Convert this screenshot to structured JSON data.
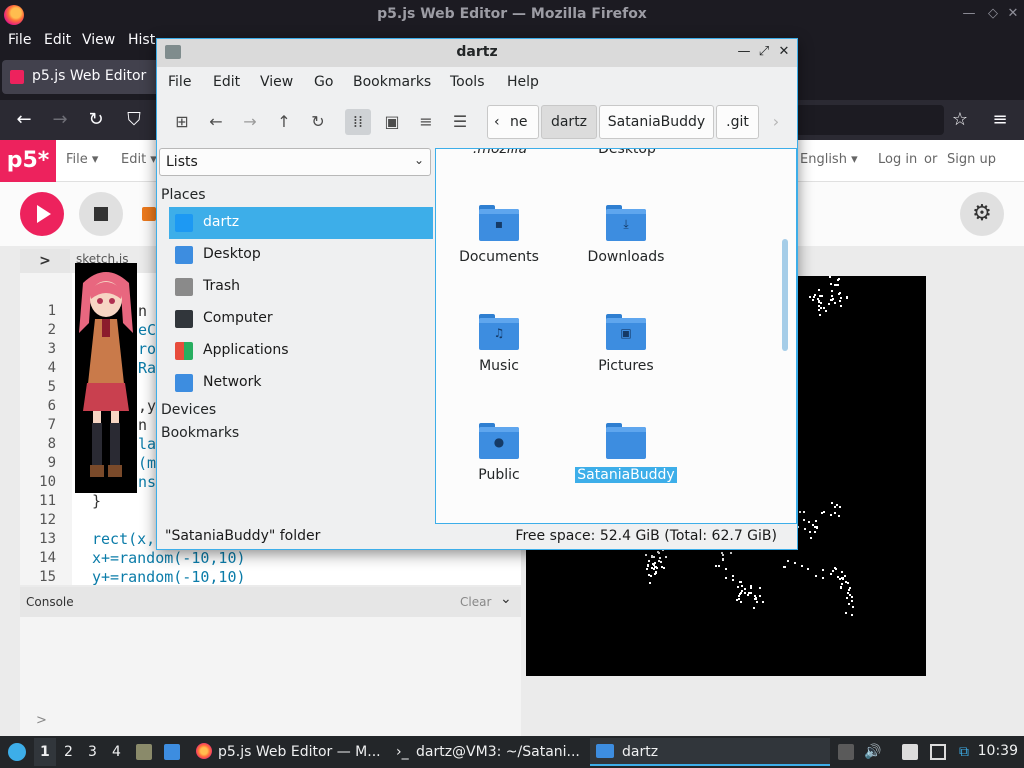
{
  "firefox": {
    "window_title": "p5.js Web Editor — Mozilla Firefox",
    "menu": [
      "File",
      "Edit",
      "View",
      "Hist"
    ],
    "tab_title": "p5.js Web Editor"
  },
  "p5": {
    "logo": "p5*",
    "menu": [
      "File ▾",
      "Edit ▾"
    ],
    "language": "English ▾",
    "login": "Log in",
    "or": "or",
    "signup": "Sign up",
    "sidebar_toggle": ">",
    "sketch_tab": "sketch.js",
    "line_numbers": [
      "1",
      "2",
      "3",
      "4",
      "5",
      "6",
      "7",
      "8",
      "9",
      "10",
      "11",
      "12",
      "13",
      "14",
      "15"
    ],
    "code_visible": {
      "l1": "n",
      "l2": "eC",
      "l3": "ro",
      "l4": "Ra",
      "l6": ",y",
      "l7": "n",
      "l8": "la",
      "l9": "(m",
      "l10": "ns",
      "l11": "}",
      "l13": "rect(x,",
      "l14": "x+=random(-10,10)",
      "l15": "y+=random(-10,10)"
    },
    "console": {
      "title": "Console",
      "clear": "Clear",
      "chevron": "⌄",
      "prompt": ">"
    }
  },
  "filemanager": {
    "title": "dartz",
    "menu": [
      "File",
      "Edit",
      "View",
      "Go",
      "Bookmarks",
      "Tools",
      "Help"
    ],
    "breadcrumbs": [
      "ne",
      "dartz",
      "SataniaBuddy",
      ".git"
    ],
    "places_select": "Lists",
    "sidebar_headers": {
      "places": "Places",
      "devices": "Devices",
      "bookmarks": "Bookmarks"
    },
    "places": [
      {
        "label": "dartz",
        "icon": "home-folder-icon",
        "color": "#1d99f3"
      },
      {
        "label": "Desktop",
        "icon": "desktop-icon",
        "color": "#3d8de0"
      },
      {
        "label": "Trash",
        "icon": "trash-icon",
        "color": "#8a8a8a"
      },
      {
        "label": "Computer",
        "icon": "computer-icon",
        "color": "#31363b"
      },
      {
        "label": "Applications",
        "icon": "applications-icon",
        "color": "#e74c3c"
      },
      {
        "label": "Network",
        "icon": "network-icon",
        "color": "#3d8de0"
      }
    ],
    "partial_labels": {
      "left": ".mozilla",
      "right": "Desktop"
    },
    "folders": [
      {
        "name": "Documents",
        "glyph": "▪"
      },
      {
        "name": "Downloads",
        "glyph": "⤓"
      },
      {
        "name": "Music",
        "glyph": "♫"
      },
      {
        "name": "Pictures",
        "glyph": "▣"
      },
      {
        "name": "Public",
        "glyph": "●"
      },
      {
        "name": "SataniaBuddy",
        "glyph": ""
      }
    ],
    "selected_folder": "SataniaBuddy",
    "status_left": "\"SataniaBuddy\" folder",
    "status_right": "Free space: 52.4 GiB (Total: 62.7 GiB)"
  },
  "taskbar": {
    "workspaces": [
      "1",
      "2",
      "3",
      "4"
    ],
    "tasks": [
      "p5.js Web Editor — M...",
      "dartz@VM3: ~/Satani...",
      "dartz"
    ],
    "clock": "10:39"
  },
  "colors": {
    "accent": "#3daee9",
    "p5_pink": "#ed225d",
    "folder_blue": "#3d8de0"
  }
}
